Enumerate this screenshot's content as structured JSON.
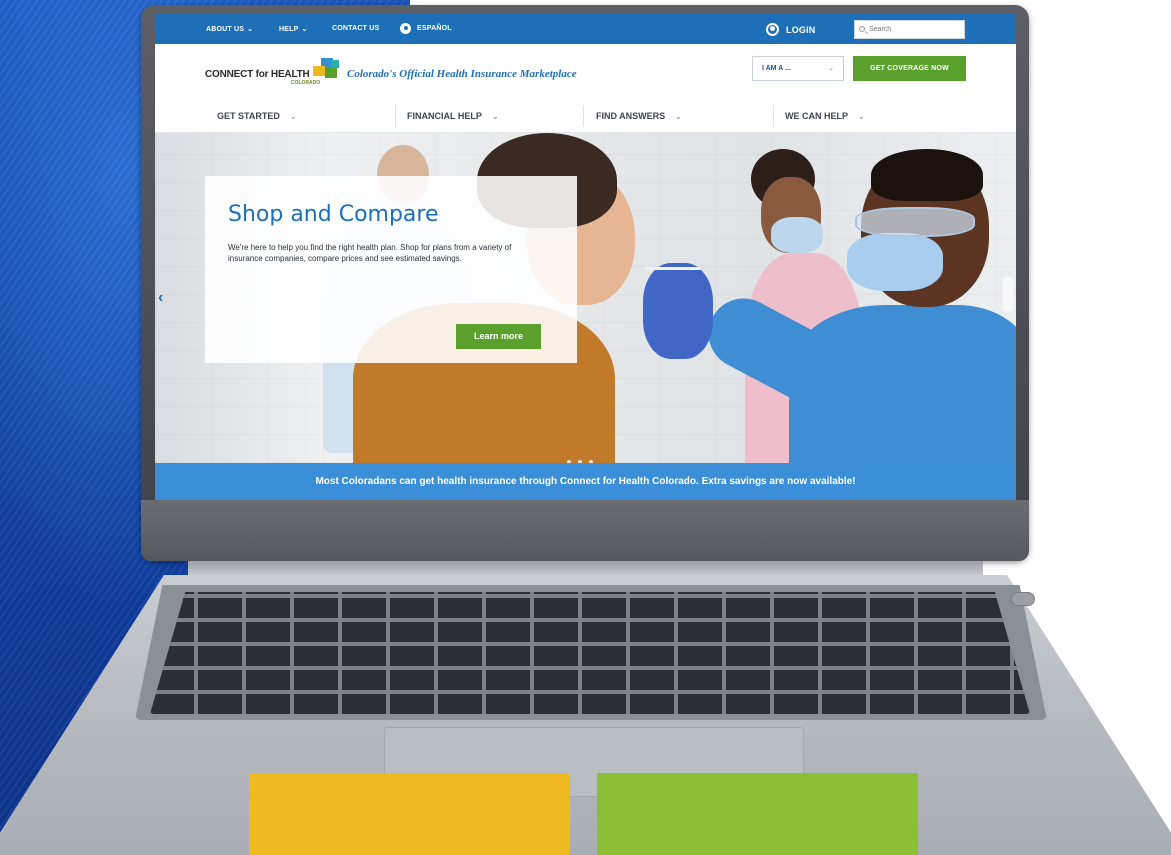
{
  "utility": {
    "about_us": "ABOUT US",
    "help": "HELP",
    "contact_us": "CONTACT US",
    "espanol": "ESPAÑOL",
    "login": "LOGIN",
    "search_placeholder": "Search"
  },
  "header": {
    "logo_text": "CONNECT for HEALTH",
    "logo_sub": "COLORADO",
    "tagline": "Colorado's Official Health Insurance Marketplace",
    "iam_label": "I AM A ...",
    "coverage_button": "GET COVERAGE NOW"
  },
  "nav": {
    "items": [
      {
        "label": "GET STARTED"
      },
      {
        "label": "FINANCIAL HELP"
      },
      {
        "label": "FIND ANSWERS"
      },
      {
        "label": "WE CAN HELP"
      }
    ]
  },
  "hero": {
    "title": "Shop and Compare",
    "body": "We're here to help you find the right health plan. Shop for plans from a variety of insurance companies, compare prices and see estimated savings.",
    "button": "Learn more",
    "prev_glyph": "‹"
  },
  "announcement": "Most Coloradans can get health insurance through Connect for Health Colorado. Extra savings are now available!",
  "colors": {
    "brand_blue": "#1d6fb8",
    "brand_green": "#5aa02c",
    "banner_blue": "#3b8fd8",
    "block_yellow": "#f1b920",
    "block_green": "#8cbf36"
  }
}
